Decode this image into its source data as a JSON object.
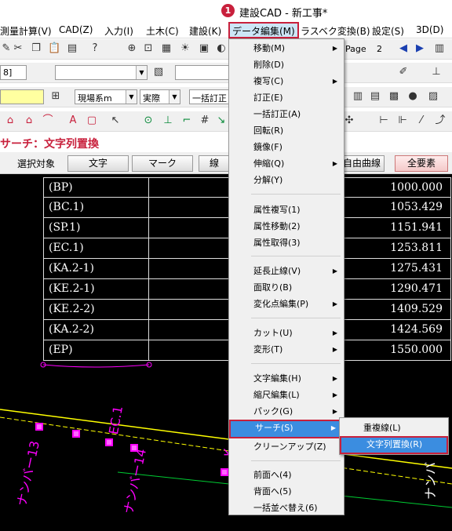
{
  "window": {
    "title": "建設CAD - 新工事*",
    "step_badge": "1"
  },
  "menubar": {
    "items": [
      "測量計算(V)",
      "CAD(Z)",
      "入力(I)",
      "土木(C)",
      "建設(K)",
      "データ編集(M)",
      "ラスベク変換(B)",
      "設定(S)",
      "3D(D)"
    ]
  },
  "toolbar": {
    "page_label": "Page",
    "page_number": "2",
    "combo1": "8]",
    "combo2": "",
    "combo3": "",
    "coord_system": "現場系m",
    "scale": "実際",
    "batch_label": "一括訂正"
  },
  "panel_title": "サーチ：文字列置換",
  "filterbar": {
    "label": "選択対象",
    "buttons": [
      "文字",
      "マーク",
      "線",
      "自由曲線",
      "全要素"
    ]
  },
  "table_rows": [
    {
      "label": "(BP)",
      "value": "1000.000"
    },
    {
      "label": "(BC.1)",
      "value": "1053.429"
    },
    {
      "label": "(SP.1)",
      "value": "1151.941"
    },
    {
      "label": "(EC.1)",
      "value": "1253.811"
    },
    {
      "label": "(KA.2-1)",
      "value": "1275.431"
    },
    {
      "label": "(KE.2-1)",
      "value": "1290.471"
    },
    {
      "label": "(KE.2-2)",
      "value": "1409.529"
    },
    {
      "label": "(KA.2-2)",
      "value": "1424.569"
    },
    {
      "label": "(EP)",
      "value": "1550.000"
    }
  ],
  "canvas_texts": [
    "ナンバー13",
    "ナンバー14",
    "EC.1",
    "ナンバ",
    "K"
  ],
  "data_menu": {
    "items": [
      {
        "label": "移動(M)",
        "sub": true
      },
      {
        "label": "削除(D)",
        "sub": false
      },
      {
        "label": "複写(C)",
        "sub": true
      },
      {
        "label": "訂正(E)",
        "sub": false
      },
      {
        "label": "一括訂正(A)",
        "sub": false
      },
      {
        "label": "回転(R)",
        "sub": false
      },
      {
        "label": "鏡像(F)",
        "sub": false
      },
      {
        "label": "伸縮(Q)",
        "sub": true
      },
      {
        "label": "分解(Y)",
        "sub": false
      },
      {
        "label": "属性複写(1)",
        "sub": false
      },
      {
        "label": "属性移動(2)",
        "sub": false
      },
      {
        "label": "属性取得(3)",
        "sub": false
      },
      {
        "label": "延長止線(V)",
        "sub": true
      },
      {
        "label": "面取り(B)",
        "sub": false
      },
      {
        "label": "変化点編集(P)",
        "sub": true
      },
      {
        "label": "カット(U)",
        "sub": true
      },
      {
        "label": "変形(T)",
        "sub": true
      },
      {
        "label": "文字編集(H)",
        "sub": true
      },
      {
        "label": "縮尺編集(L)",
        "sub": true
      },
      {
        "label": "パック(G)",
        "sub": true
      },
      {
        "label": "サーチ(S)",
        "sub": true
      },
      {
        "label": "クリーンアップ(Z)",
        "sub": false
      },
      {
        "label": "前面へ(4)",
        "sub": false
      },
      {
        "label": "背面へ(5)",
        "sub": false
      },
      {
        "label": "一括並べ替え(6)",
        "sub": false
      }
    ]
  },
  "search_submenu": {
    "items": [
      {
        "label": "重複線(L)"
      },
      {
        "label": "文字列置換(R)"
      }
    ]
  },
  "colors": {
    "accent": "#c8203c",
    "highlight": "#3b8de0",
    "canvas": "#000000",
    "magenta": "#ff00ff"
  }
}
